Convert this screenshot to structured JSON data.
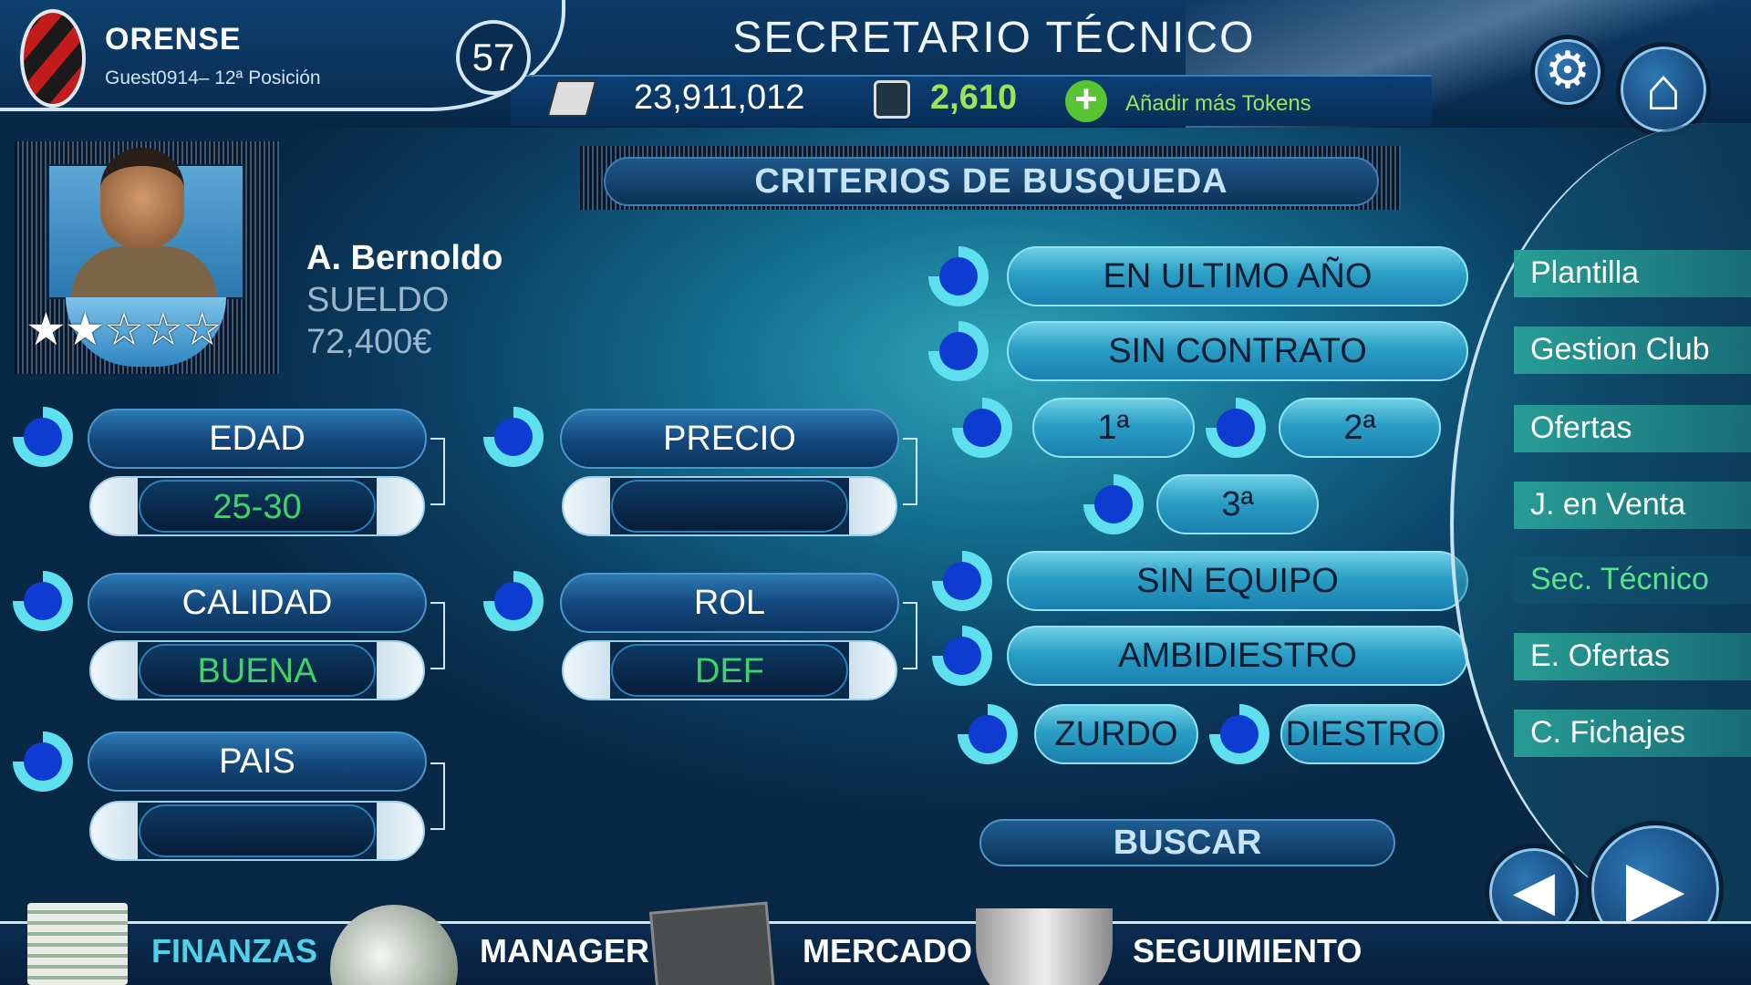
{
  "header": {
    "club_name": "ORENSE",
    "club_sub": "Guest0914– 12ª Posición",
    "level": "57",
    "title": "SECRETARIO TÉCNICO",
    "money": "23,911,012",
    "tokens": "2,610",
    "add_tokens_label": "Añadir más Tokens",
    "icons": [
      "cash-icon",
      "token-icon",
      "plus-icon",
      "gear-icon",
      "home-icon"
    ]
  },
  "employee": {
    "name": "A. Bernoldo",
    "salary_label": "SUELDO",
    "salary_value": "72,400€",
    "rating": 2,
    "rating_max": 5,
    "stars": "★★☆☆☆"
  },
  "search": {
    "title": "CRITERIOS DE BUSQUEDA",
    "filters": {
      "edad": {
        "label": "EDAD",
        "value": "25-30"
      },
      "precio": {
        "label": "PRECIO",
        "value": ""
      },
      "calidad": {
        "label": "CALIDAD",
        "value": "BUENA"
      },
      "rol": {
        "label": "ROL",
        "value": "DEF"
      },
      "pais": {
        "label": "PAIS",
        "value": ""
      }
    },
    "options": {
      "ultimo_ano": "EN ULTIMO AÑO",
      "sin_contrato": "SIN CONTRATO",
      "div1": "1ª",
      "div2": "2ª",
      "div3": "3ª",
      "sin_equipo": "SIN EQUIPO",
      "ambidiestro": "AMBIDIESTRO",
      "zurdo": "ZURDO",
      "diestro": "DIESTRO"
    },
    "button": "BUSCAR"
  },
  "menu": [
    "Plantilla",
    "Gestion Club",
    "Ofertas",
    "J. en Venta",
    "Sec. Técnico",
    "E. Ofertas",
    "C. Fichajes"
  ],
  "menu_selected": "Sec. Técnico",
  "footer": [
    "FINANZAS",
    "MANAGER",
    "MERCADO",
    "SEGUIMIENTO"
  ],
  "colors": {
    "accent": "#3fd36a",
    "tokens": "#9be45a",
    "toggle": "#0e3cd0",
    "menu_bg": "#28a096"
  }
}
